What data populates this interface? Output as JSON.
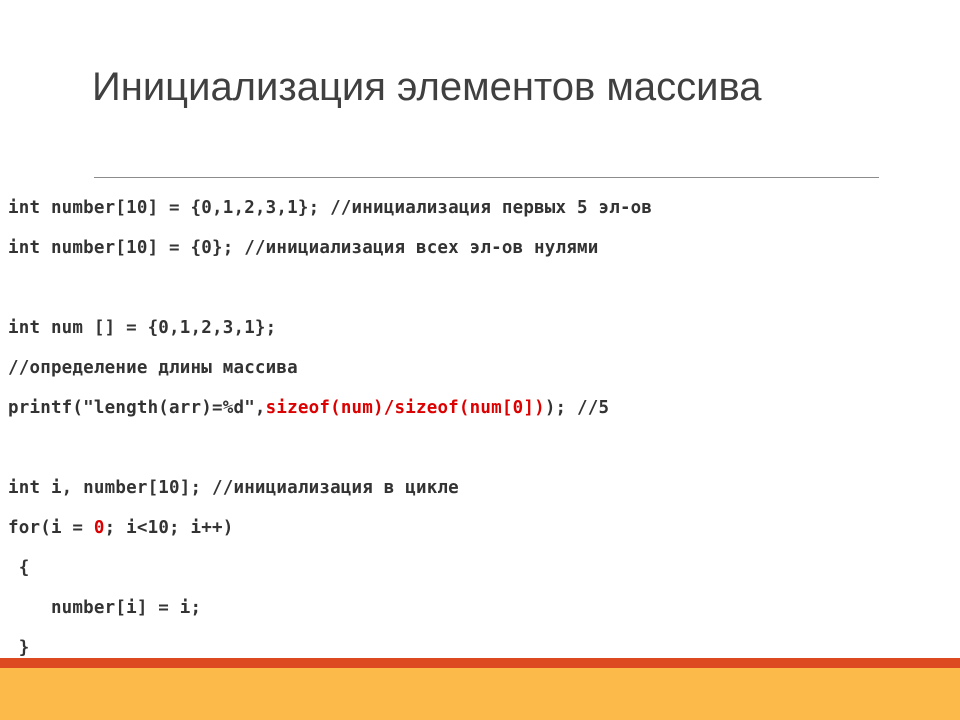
{
  "slide": {
    "title": "Инициализация элементов массива",
    "background_color": "#ffffff",
    "title_color": "#404040",
    "code_color": "#333333",
    "accent_red": "#dd0000",
    "footer_bar_top_color": "#dd4a22",
    "footer_bar_bottom_color": "#fcba4b",
    "rule_color": "#8c8c8c"
  },
  "code": {
    "lines": [
      {
        "id": "line-1",
        "segments": [
          {
            "text": "int number[10] = {0,1,2,3,1}; //инициализация первых 5 эл-ов",
            "color": "default"
          }
        ]
      },
      {
        "id": "line-2",
        "segments": [
          {
            "text": "int number[10] = {0}; //инициализация всех эл-ов нулями",
            "color": "default"
          }
        ]
      },
      {
        "id": "line-3",
        "segments": [
          {
            "text": "",
            "color": "default"
          }
        ]
      },
      {
        "id": "line-4",
        "segments": [
          {
            "text": "int num [] = {0,1,2,3,1};",
            "color": "default"
          }
        ]
      },
      {
        "id": "line-5",
        "segments": [
          {
            "text": "//определение длины массива",
            "color": "default"
          }
        ]
      },
      {
        "id": "line-6",
        "segments": [
          {
            "text": "printf(\"length(arr)=%d\",",
            "color": "default"
          },
          {
            "text": "sizeof(num)/sizeof(num[0])",
            "color": "red"
          },
          {
            "text": "); //5",
            "color": "default"
          }
        ]
      },
      {
        "id": "line-7",
        "segments": [
          {
            "text": "",
            "color": "default"
          }
        ]
      },
      {
        "id": "line-8",
        "segments": [
          {
            "text": "int i, number[10]; //инициализация в цикле",
            "color": "default"
          }
        ]
      },
      {
        "id": "line-9",
        "segments": [
          {
            "text": "for(i = ",
            "color": "default"
          },
          {
            "text": "0",
            "color": "red"
          },
          {
            "text": "; i<10; i++)",
            "color": "default"
          }
        ]
      },
      {
        "id": "line-10",
        "segments": [
          {
            "text": " {",
            "color": "default"
          }
        ]
      },
      {
        "id": "line-11",
        "segments": [
          {
            "text": "    number[i] = i;",
            "color": "default"
          }
        ]
      },
      {
        "id": "line-12",
        "segments": [
          {
            "text": " }",
            "color": "default"
          }
        ]
      }
    ]
  }
}
